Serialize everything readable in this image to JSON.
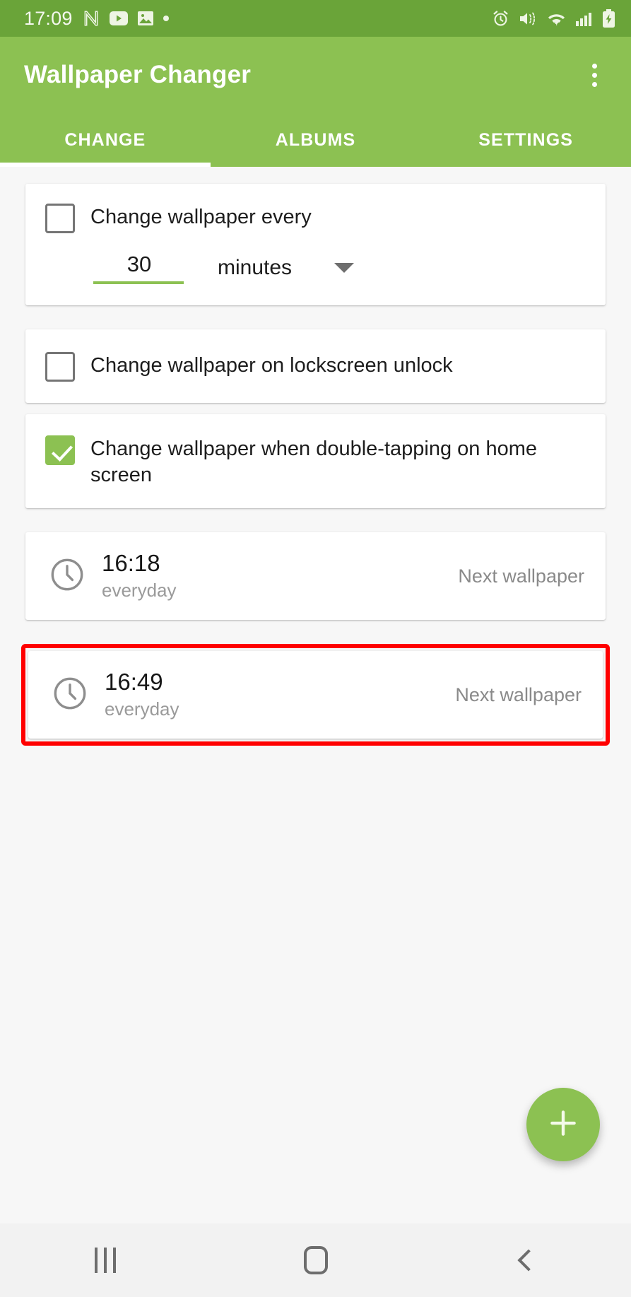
{
  "statusbar": {
    "time": "17:09",
    "left_icons": [
      "nova-launcher-icon",
      "youtube-icon",
      "gallery-icon",
      "notification-dot-icon"
    ],
    "right_icons": [
      "alarm-icon",
      "vibrate-icon",
      "wifi-icon",
      "cellular-signal-icon",
      "battery-charging-icon"
    ],
    "background_color": "#6aa439"
  },
  "appbar": {
    "title": "Wallpaper Changer",
    "overflow_label": "More options",
    "background_color": "#8cc152"
  },
  "tabs": [
    {
      "label": "CHANGE",
      "active": true
    },
    {
      "label": "ALBUMS",
      "active": false
    },
    {
      "label": "SETTINGS",
      "active": false
    }
  ],
  "cards": {
    "interval": {
      "checkbox_label": "Change wallpaper every",
      "checked": false,
      "value": "30",
      "unit": "minutes",
      "underline_color": "#8cc152"
    },
    "lockscreen": {
      "checkbox_label": "Change wallpaper on lockscreen unlock",
      "checked": false
    },
    "doubletap": {
      "checkbox_label": "Change wallpaper when double-tapping on home screen",
      "checked": true,
      "check_color": "#8cc152"
    }
  },
  "schedules": [
    {
      "time": "16:18",
      "repeat": "everyday",
      "action": "Next wallpaper",
      "highlighted": false
    },
    {
      "time": "16:49",
      "repeat": "everyday",
      "action": "Next wallpaper",
      "highlighted": true
    }
  ],
  "highlight_color": "#ff0000",
  "fab": {
    "icon": "plus-icon",
    "label": "Add schedule",
    "color": "#8cc152"
  },
  "navbar": {
    "recents_label": "Recents",
    "home_label": "Home",
    "back_label": "Back"
  }
}
